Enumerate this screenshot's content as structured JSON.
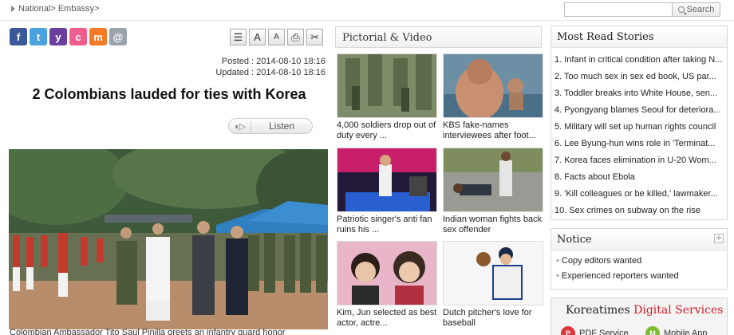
{
  "breadcrumb": "National> Embassy>",
  "search": {
    "placeholder": "",
    "button": "Search"
  },
  "share_icons": [
    {
      "name": "facebook-icon",
      "glyph": "f",
      "color": "#3b5998"
    },
    {
      "name": "twitter-icon",
      "glyph": "t",
      "color": "#4aa3df"
    },
    {
      "name": "yozm-icon",
      "glyph": "y",
      "color": "#6b3fa0"
    },
    {
      "name": "cyworld-icon",
      "glyph": "c",
      "color": "#ee5f90"
    },
    {
      "name": "me2day-icon",
      "glyph": "m",
      "color": "#f37b26"
    },
    {
      "name": "email-icon",
      "glyph": "@",
      "color": "#9aa3ad"
    }
  ],
  "tools": [
    {
      "name": "list-view-icon",
      "glyph": "☰"
    },
    {
      "name": "font-larger-icon",
      "glyph": "A"
    },
    {
      "name": "font-smaller-icon",
      "glyph": "A"
    },
    {
      "name": "print-icon",
      "glyph": "⎙"
    },
    {
      "name": "scrap-icon",
      "glyph": "✂"
    }
  ],
  "article": {
    "posted": "Posted : 2014-08-10 18:16",
    "updated": "Updated : 2014-08-10 18:16",
    "headline": "2 Colombians lauded for ties with Korea",
    "listen_label": "Listen",
    "caption": "Colombian Ambassador Tito Saul Pinilla greets an infantry guard honor"
  },
  "pictorial": {
    "title": "Pictorial & Video",
    "items": [
      {
        "caption": "4,000 soldiers drop out of duty every ..."
      },
      {
        "caption": "KBS fake-names interviewees after foot..."
      },
      {
        "caption": "Patriotic singer's anti fan ruins his ..."
      },
      {
        "caption": "Indian woman fights back sex offender"
      },
      {
        "caption": "Kim, Jun selected as best actor, actre..."
      },
      {
        "caption": "Dutch pitcher's love for baseball"
      }
    ]
  },
  "most_read": {
    "title": "Most Read Stories",
    "items": [
      "1. Infant in critical condition after taking N...",
      "2. Too much sex in sex ed book, US par...",
      "3. Toddler breaks into White House, sen...",
      "4. Pyongyang blames Seoul for deteriora...",
      "5. Military will set up human rights council",
      "6. Lee Byung-hun wins role in 'Terminat...",
      "7. Korea faces elimination in U-20 Wom...",
      "8. Facts about Ebola",
      "9. 'Kill colleagues or be killed,' lawmaker...",
      "10. Sex crimes on subway on the rise"
    ]
  },
  "notice": {
    "title": "Notice",
    "more": "+",
    "items": [
      "Copy editors wanted",
      "Experienced reporters wanted"
    ]
  },
  "digital": {
    "brand": "Koreatimes",
    "highlight": "Digital Services",
    "services": [
      {
        "label": "PDF Service",
        "color": "#d9363e",
        "glyph": "P"
      },
      {
        "label": "Mobile App",
        "color": "#7dbb2f",
        "glyph": "M"
      }
    ]
  }
}
